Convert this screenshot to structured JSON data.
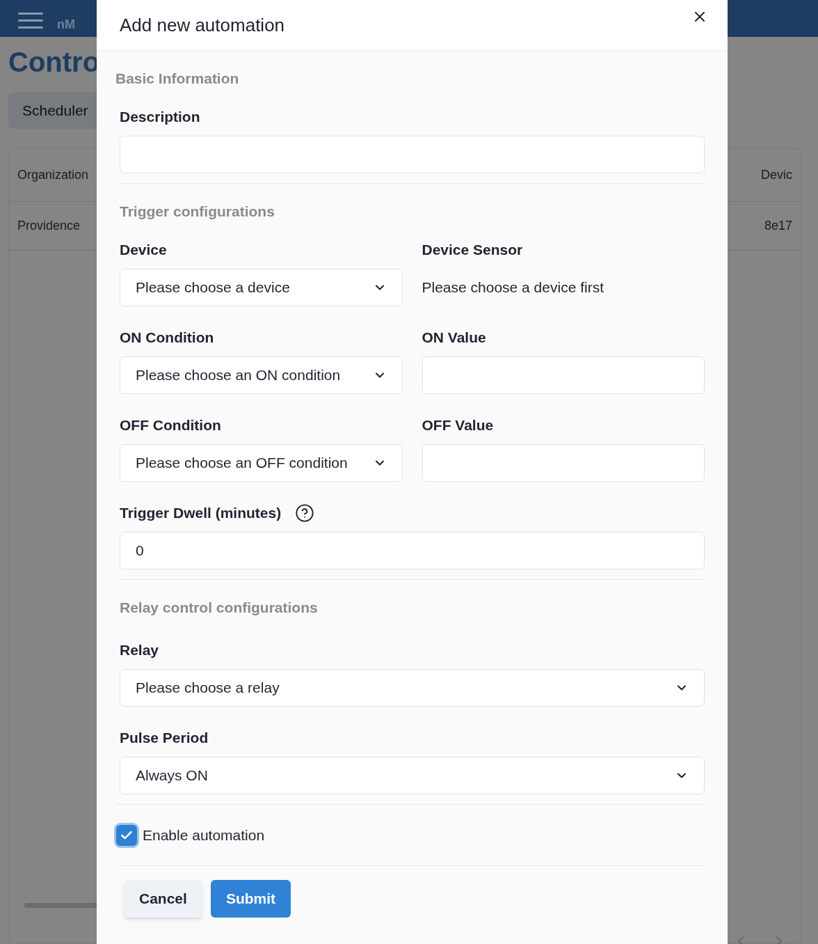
{
  "page": {
    "brand": "nM",
    "title": "Contro",
    "tabs": [
      {
        "label": "Scheduler",
        "selected": true
      }
    ],
    "table": {
      "columns": [
        "Organization",
        "Devic"
      ],
      "rows": [
        [
          "Providence",
          "8e17"
        ]
      ]
    }
  },
  "modal": {
    "title": "Add new automation",
    "sections": [
      {
        "heading": "Basic Information",
        "rows": [
          [
            {
              "kind": "text",
              "label": "Description"
            }
          ]
        ]
      },
      {
        "heading": "Trigger configurations",
        "rows": [
          [
            {
              "kind": "select",
              "label": "Device",
              "value": "Please choose a device"
            },
            {
              "kind": "note",
              "label": "Device Sensor",
              "value": "Please choose a device first"
            }
          ],
          [
            {
              "kind": "select",
              "label": "ON Condition",
              "value": "Please choose an ON condition"
            },
            {
              "kind": "text",
              "label": "ON Value"
            }
          ],
          [
            {
              "kind": "select",
              "label": "OFF Condition",
              "value": "Please choose an OFF condition"
            },
            {
              "kind": "text",
              "label": "OFF Value"
            }
          ],
          [
            {
              "kind": "text",
              "label": "Trigger Dwell (minutes)",
              "help": true,
              "value": "0"
            }
          ]
        ]
      },
      {
        "heading": "Relay control configurations",
        "rows": [
          [
            {
              "kind": "select",
              "label": "Relay",
              "value": "Please choose a relay"
            }
          ],
          [
            {
              "kind": "select",
              "label": "Pulse Period",
              "value": "Always ON"
            }
          ]
        ]
      }
    ],
    "enable": {
      "label": "Enable automation",
      "checked": true
    },
    "buttons": [
      {
        "label": "Cancel",
        "kind": "secondary"
      },
      {
        "label": "Submit",
        "kind": "primary"
      }
    ]
  }
}
